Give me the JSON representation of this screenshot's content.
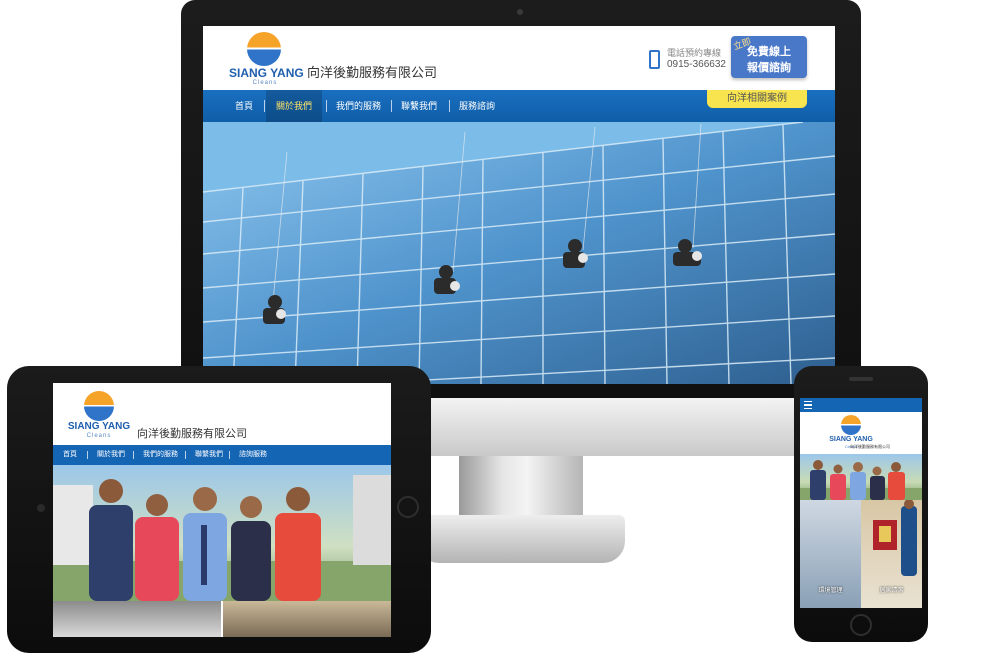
{
  "brand": {
    "logo_text": "SIANG YANG",
    "logo_sub": "Cleans",
    "company_name": "向洋後勤服務有限公司"
  },
  "desktop": {
    "phone_label": "電話預約專線",
    "phone_number": "0915-366632",
    "cta_tag": "立即",
    "cta_line1": "免費線上",
    "cta_line2": "報價諮詢",
    "cases_tab": "向洋相關案例",
    "nav": [
      "首頁",
      "關於我們",
      "我們的服務",
      "聯繫我們",
      "服務諮詢"
    ],
    "active_nav": "關於我們"
  },
  "tablet": {
    "nav": [
      "首頁",
      "關於我們",
      "我們的服務",
      "聯繫我們",
      "諮詢服務"
    ]
  },
  "phone": {
    "tile_left_caption": "環境管理",
    "tile_right_caption": "居家清潔"
  },
  "colors": {
    "nav_blue": "#1565b5",
    "cta_blue": "#4a78c8",
    "cases_yellow": "#f7e44f",
    "logo_orange": "#f6a32a",
    "active_text": "#ffe36a"
  }
}
